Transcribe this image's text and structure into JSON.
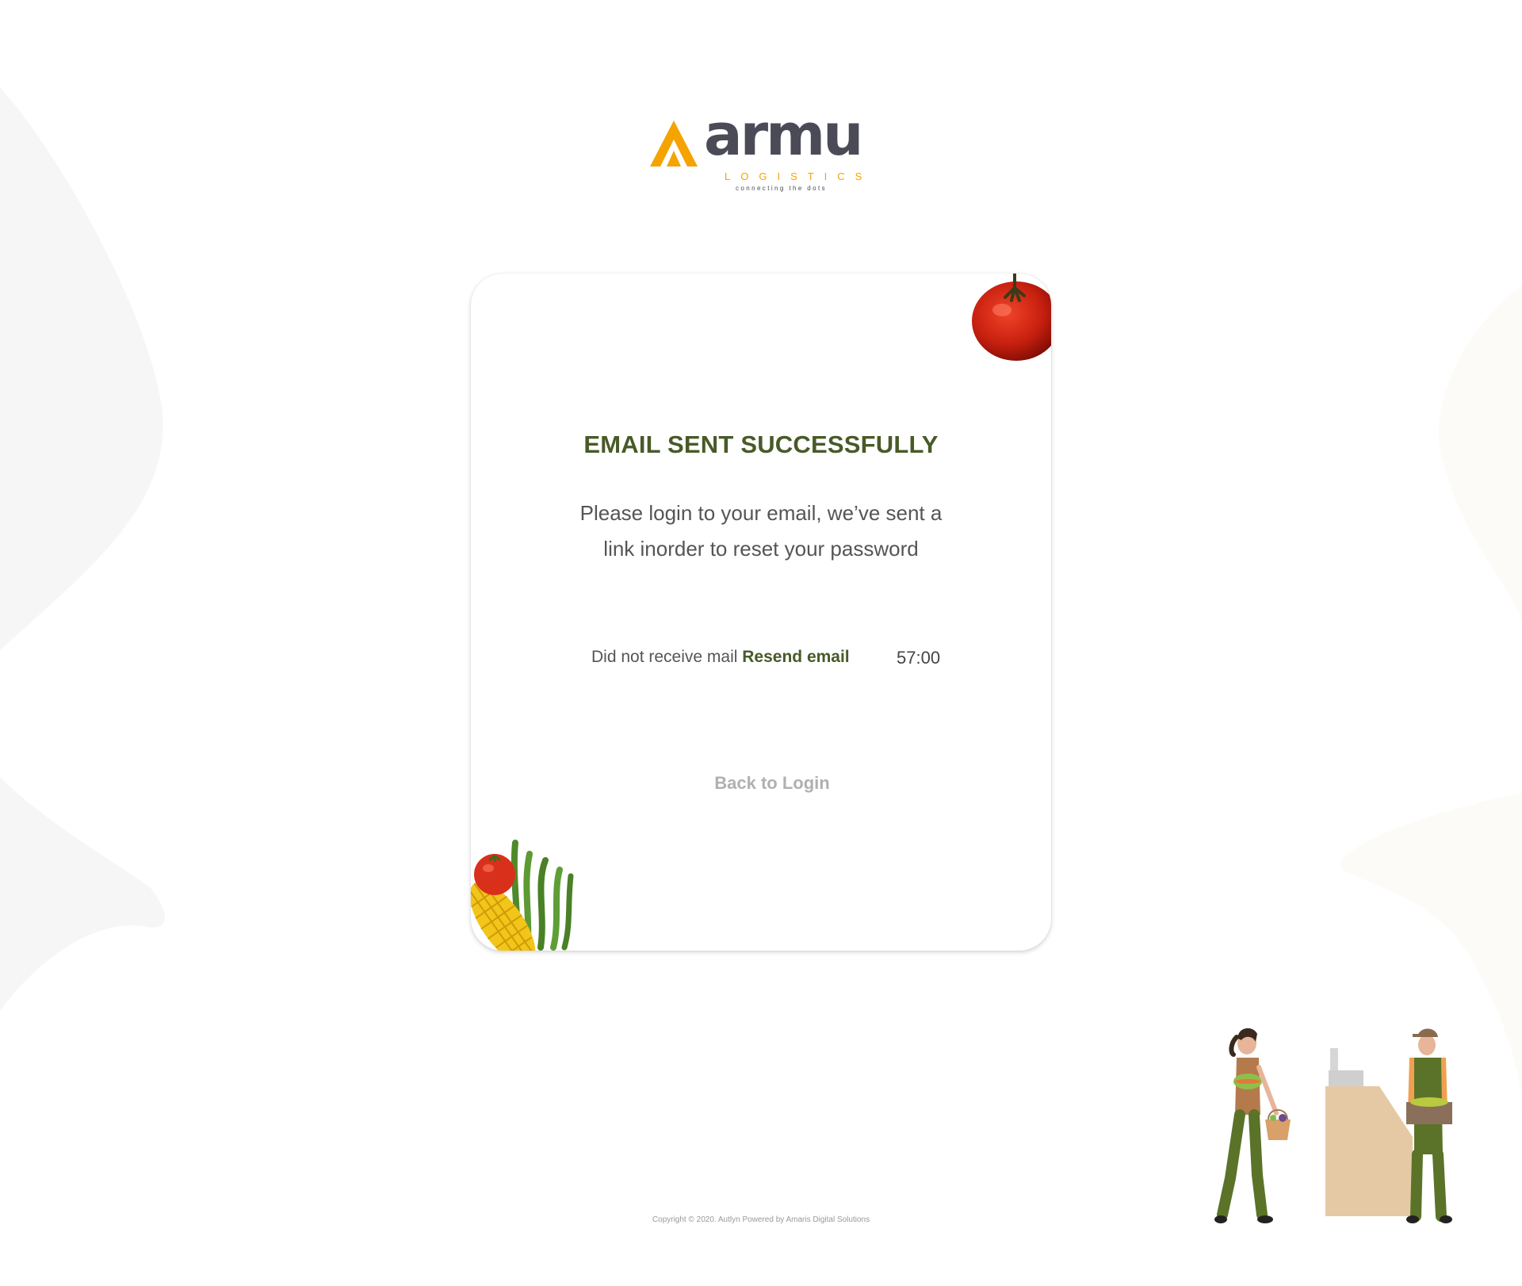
{
  "logo": {
    "word": "armu",
    "subtitle": "LOGISTICS",
    "tagline": "connecting the dots",
    "brand_color": "#f5a300",
    "text_color": "#4b4b58"
  },
  "card": {
    "title": "EMAIL SENT SUCCESSFULLY",
    "message": "Please login to your email, we’ve sent a link inorder to reset your password",
    "resend_prompt": "Did not receive mail",
    "resend_link": "Resend email",
    "timer": "57:00",
    "back_link": "Back to Login",
    "title_color": "#485a28"
  },
  "footer": {
    "copyright": "Copyright © 2020. Autlyn Powered by Amaris Digital Solutions"
  }
}
